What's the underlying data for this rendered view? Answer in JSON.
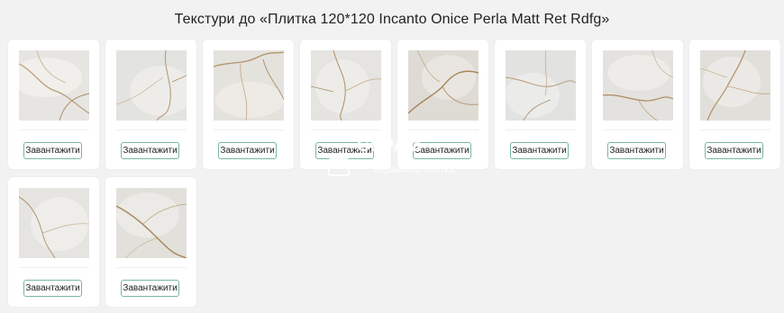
{
  "page": {
    "title": "Текстури до «Плитка 120*120 Incanto Onice Perla Matt Ret Rdfg»",
    "accent_color": "#79b79f"
  },
  "textures": [
    {
      "button_label": "Завантажити"
    },
    {
      "button_label": "Завантажити"
    },
    {
      "button_label": "Завантажити"
    },
    {
      "button_label": "Завантажити"
    },
    {
      "button_label": "Завантажити"
    },
    {
      "button_label": "Завантажити"
    },
    {
      "button_label": "Завантажити"
    },
    {
      "button_label": "Завантажити"
    },
    {
      "button_label": "Завантажити"
    },
    {
      "button_label": "Завантажити"
    }
  ],
  "watermark": {
    "brand": "СЕРАМ",
    "subtitle": "Керамічна плитка"
  }
}
